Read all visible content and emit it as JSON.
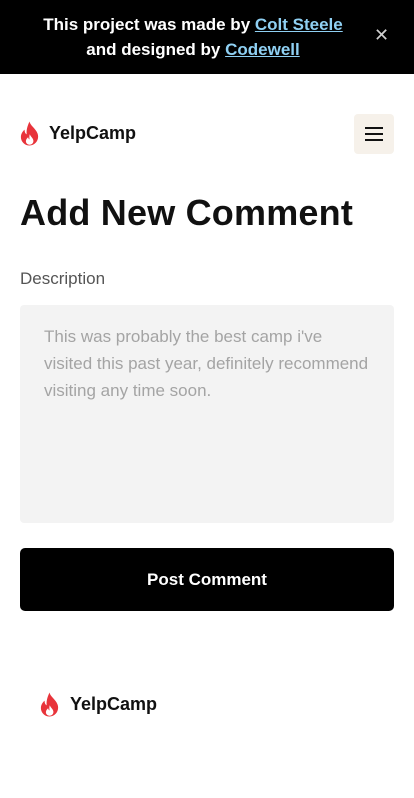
{
  "banner": {
    "text_1": "This project was made by ",
    "link_1": "Colt Steele",
    "text_2": " and designed by ",
    "link_2": "Codewell",
    "close_icon": "close-icon",
    "close_glyph": "✕"
  },
  "navbar": {
    "logo_icon": "flame-icon",
    "logo_text": "YelpCamp",
    "menu_icon": "hamburger-menu-icon"
  },
  "main": {
    "title": "Add New Comment",
    "description_label": "Description",
    "description_value": "",
    "description_placeholder": "This was probably the best camp i've visited this past year, definitely recommend visiting any time soon.",
    "submit_label": "Post Comment"
  },
  "footer": {
    "logo_icon": "flame-icon",
    "logo_text": "YelpCamp"
  },
  "colors": {
    "brand_flame": "#e8343b",
    "banner_bg": "#000000",
    "banner_link": "#8fd0f3",
    "menu_button_bg": "#f6f1ea",
    "input_bg": "#f3f3f3",
    "button_bg": "#000000"
  }
}
